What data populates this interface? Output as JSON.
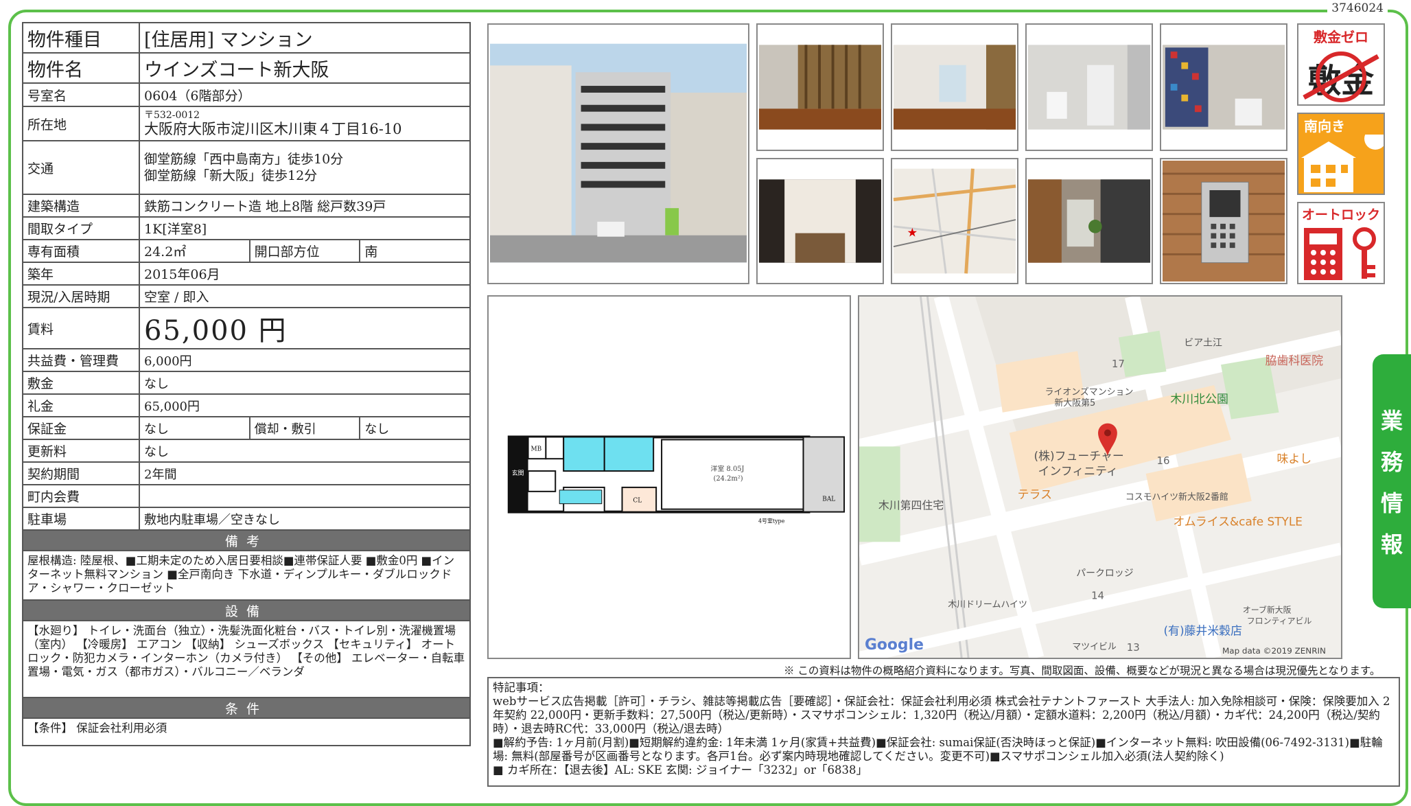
{
  "doc_id": "3746024",
  "property": {
    "type_label": "物件種目",
    "type_value": "[住居用] マンション",
    "name_label": "物件名",
    "name_value": "ウインズコート新大阪",
    "room_label": "号室名",
    "room_value": "0604（6階部分）",
    "address_label": "所在地",
    "zip": "〒532-0012",
    "address": "大阪府大阪市淀川区木川東４丁目16-10",
    "access_label": "交通",
    "access_1": "御堂筋線「西中島南方」徒歩10分",
    "access_2": "御堂筋線「新大阪」徒歩12分",
    "structure_label": "建築構造",
    "structure_value": "鉄筋コンクリート造 地上8階 総戸数39戸",
    "layout_label": "間取タイプ",
    "layout_value": "1K[洋室8]",
    "area_label": "専有面積",
    "area_value": "24.2㎡",
    "direction_label": "開口部方位",
    "direction_value": "南",
    "built_label": "築年",
    "built_value": "2015年06月",
    "status_label": "現況/入居時期",
    "status_value": "空室 / 即入",
    "rent_label": "賃料",
    "rent_value": "65,000 円",
    "fee_label": "共益費・管理費",
    "fee_value": "6,000円",
    "deposit_label": "敷金",
    "deposit_value": "なし",
    "keymoney_label": "礼金",
    "keymoney_value": "65,000円",
    "guarantee_label": "保証金",
    "guarantee_value": "なし",
    "amort_label": "償却・敷引",
    "amort_value": "なし",
    "renewal_label": "更新料",
    "renewal_value": "なし",
    "term_label": "契約期間",
    "term_value": "2年間",
    "town_fee_label": "町内会費",
    "town_fee_value": "",
    "parking_label": "駐車場",
    "parking_value": "敷地内駐車場／空きなし"
  },
  "sections": {
    "notes_title": "備考",
    "notes_text": "屋根構造: 陸屋根、■工期未定のため入居日要相談■連帯保証人要 ■敷金0円 ■インターネット無料マンション ■全戸南向き 下水道・ディンプルキー・ダブルロックドア・シャワー・クローゼット",
    "equipment_title": "設備",
    "equipment_text": "【水廻り】 トイレ・洗面台（独立）・洗髪洗面化粧台・バス・トイレ別・洗濯機置場（室内） 【冷暖房】 エアコン 【収納】 シューズボックス 【セキュリティ】 オートロック・防犯カメラ・インターホン（カメラ付き） 【その他】 エレベーター・自転車置場・電気・ガス（都市ガス）・バルコニー／ベランダ",
    "conditions_title": "条件",
    "conditions_text": "【条件】 保証会社利用必須"
  },
  "badges": {
    "zero_deposit": "敷金ゼロ",
    "zero_deposit_strike": "敷金",
    "south": "南向き",
    "autolock": "オートロック"
  },
  "floorplan": {
    "room_label": "洋室 8.05J",
    "room_area": "(24.2m²)",
    "type_label": "4号室type",
    "mb": "MB",
    "entrance": "玄関",
    "cl": "CL",
    "bal": "BAL"
  },
  "map": {
    "labels": [
      "ビア土江",
      "脇歯科医院",
      "17",
      "ライオンズマンション",
      "新大阪第5",
      "木川北公園",
      "(株)フューチャー",
      "インフィニティ",
      "16",
      "味よし",
      "木川第四住宅",
      "テラス",
      "コスモハイツ新大阪2番館",
      "オムライス&cafe STYLE",
      "パークロッジ",
      "14",
      "木川ドリームハイツ",
      "オーブ新大阪",
      "フロンティアビル",
      "(有)藤井米穀店",
      "マツイビル",
      "13",
      "Google",
      "Map data ©2019 ZENRIN"
    ]
  },
  "disclaimer": "※ この資料は物件の概略紹介資料になります。写真、間取図面、設備、概要などが現況と異なる場合は現況優先となります。",
  "remarks": {
    "title": "特記事項：",
    "line1": "webサービス広告掲載［許可］・チラシ、雑誌等掲載広告［要確認］・保証会社：保証会社利用必須 株式会社テナントファースト 大手法人: 加入免除相談可・保険：保険要加入 2年契約 22,000円・更新手数料：27,500円（税込/更新時）・スマサポコンシェル：1,320円（税込/月額）・定額水道料：2,200円（税込/月額）・カギ代：24,200円（税込/契約時）・退去時RC代：33,000円（税込/退去時）",
    "line2": "■解約予告: 1ヶ月前(月割)■短期解約違約金: 1年未満 1ヶ月(家賃+共益費)■保証会社: sumai保証(否決時ほっと保証)■インターネット無料: 吹田設備(06-7492-3131)■駐輪場: 無料(部屋番号が区画番号となります。各戸1台。必ず案内時現地確認してください。変更不可)■スマサポコンシェル加入必須(法人契約除く)",
    "line3": "■ カギ所在：【退去後】AL: SKE 玄関: ジョイナー「3232」or「6838」"
  },
  "side_tab": [
    "業",
    "務",
    "情",
    "報"
  ],
  "colors": {
    "frame": "#5cc04a",
    "banner": "#6f6f6f",
    "side_tab": "#2ead3c",
    "badge_red": "#d8282a",
    "badge_orange": "#f6a21b"
  }
}
